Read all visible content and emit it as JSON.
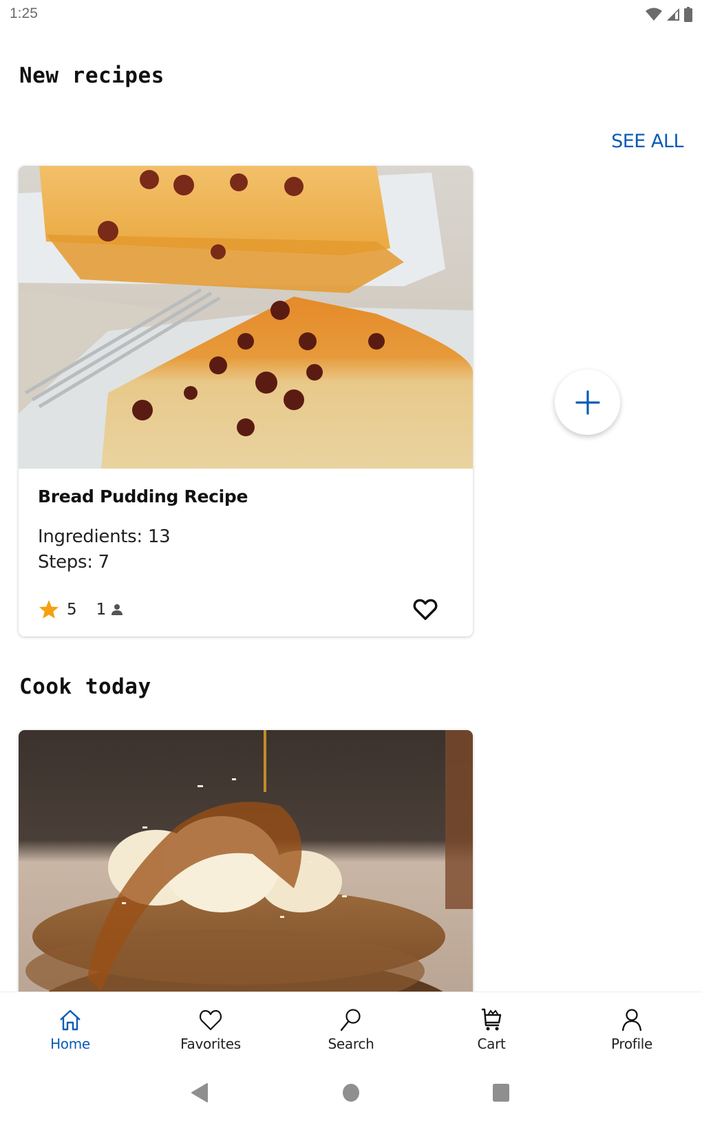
{
  "status_bar": {
    "time": "1:25",
    "icons": [
      "wifi-icon",
      "cell-signal-icon",
      "battery-icon"
    ]
  },
  "sections": {
    "new_recipes": {
      "title": "New recipes",
      "see_all_label": "SEE ALL"
    },
    "cook_today": {
      "title": "Cook today"
    }
  },
  "new_recipe_card": {
    "image_alt": "Bread pudding slices with caramel sauce and raisins",
    "title": "Bread Pudding Recipe",
    "ingredients_label": "Ingredients: 13",
    "steps_label": "Steps: 7",
    "rating": "5",
    "reviews": "1",
    "favorited": false
  },
  "cook_today_card": {
    "image_alt": "Stack of oat pancakes topped with banana slices, coconut and syrup"
  },
  "fab": {
    "icon": "plus-icon"
  },
  "bottom_nav": {
    "active": "home",
    "items": [
      {
        "id": "home",
        "label": "Home",
        "icon": "home-icon"
      },
      {
        "id": "favorites",
        "label": "Favorites",
        "icon": "heart-icon"
      },
      {
        "id": "search",
        "label": "Search",
        "icon": "search-icon"
      },
      {
        "id": "cart",
        "label": "Cart",
        "icon": "cart-icon"
      },
      {
        "id": "profile",
        "label": "Profile",
        "icon": "person-icon"
      }
    ]
  },
  "system_nav": [
    "back-icon",
    "home-circle-icon",
    "recents-icon"
  ],
  "colors": {
    "accent": "#0b5cb5",
    "star": "#f5a10f",
    "text": "#111111",
    "status_gray": "#6b6b6b",
    "system_nav_gray": "#8f8f8f"
  }
}
